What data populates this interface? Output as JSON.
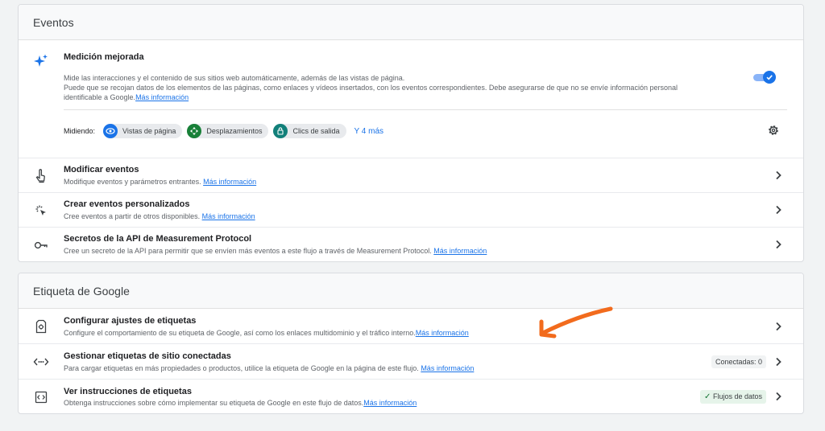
{
  "eventos": {
    "header": "Eventos",
    "medicion": {
      "title": "Medición mejorada",
      "desc_line1": "Mide las interacciones y el contenido de sus sitios web automáticamente, además de las vistas de página.",
      "desc_line2": "Puede que se recojan datos de los elementos de las páginas, como enlaces y vídeos insertados, con los eventos correspondientes. Debe asegurarse de que no se envíe información personal",
      "desc_line3": "identificable a Google.",
      "link": "Más información",
      "toggle_on": true,
      "midiendo_label": "Midiendo:",
      "chips": [
        "Vistas de página",
        "Desplazamientos",
        "Clics de salida"
      ],
      "more": "Y 4 más"
    },
    "rows": [
      {
        "title": "Modificar eventos",
        "desc": "Modifique eventos y parámetros entrantes.",
        "link": "Más información"
      },
      {
        "title": "Crear eventos personalizados",
        "desc": "Cree eventos a partir de otros disponibles.",
        "link": "Más información"
      },
      {
        "title": "Secretos de la API de Measurement Protocol",
        "desc": "Cree un secreto de la API para permitir que se envíen más eventos a este flujo a través de Measurement Protocol.",
        "link": "Más información"
      }
    ]
  },
  "etiqueta": {
    "header": "Etiqueta de Google",
    "rows": [
      {
        "title": "Configurar ajustes de etiquetas",
        "desc": "Configure el comportamiento de su etiqueta de Google, así como los enlaces multidominio y el tráfico interno.",
        "link": "Más información"
      },
      {
        "title": "Gestionar etiquetas de sitio conectadas",
        "desc": "Para cargar etiquetas en más propiedades o productos, utilice la etiqueta de Google en la página de este flujo.",
        "link": "Más información",
        "badge": "Conectadas: 0"
      },
      {
        "title": "Ver instrucciones de etiquetas",
        "desc": "Obtenga instrucciones sobre cómo implementar su etiqueta de Google en este flujo de datos.",
        "link": "Más información",
        "badge": "Flujos de datos"
      }
    ]
  },
  "colors": {
    "accent": "#1a73e8",
    "arrow": "#f26b1d",
    "success_bg": "#e6f4ea",
    "success_text": "#137333"
  }
}
